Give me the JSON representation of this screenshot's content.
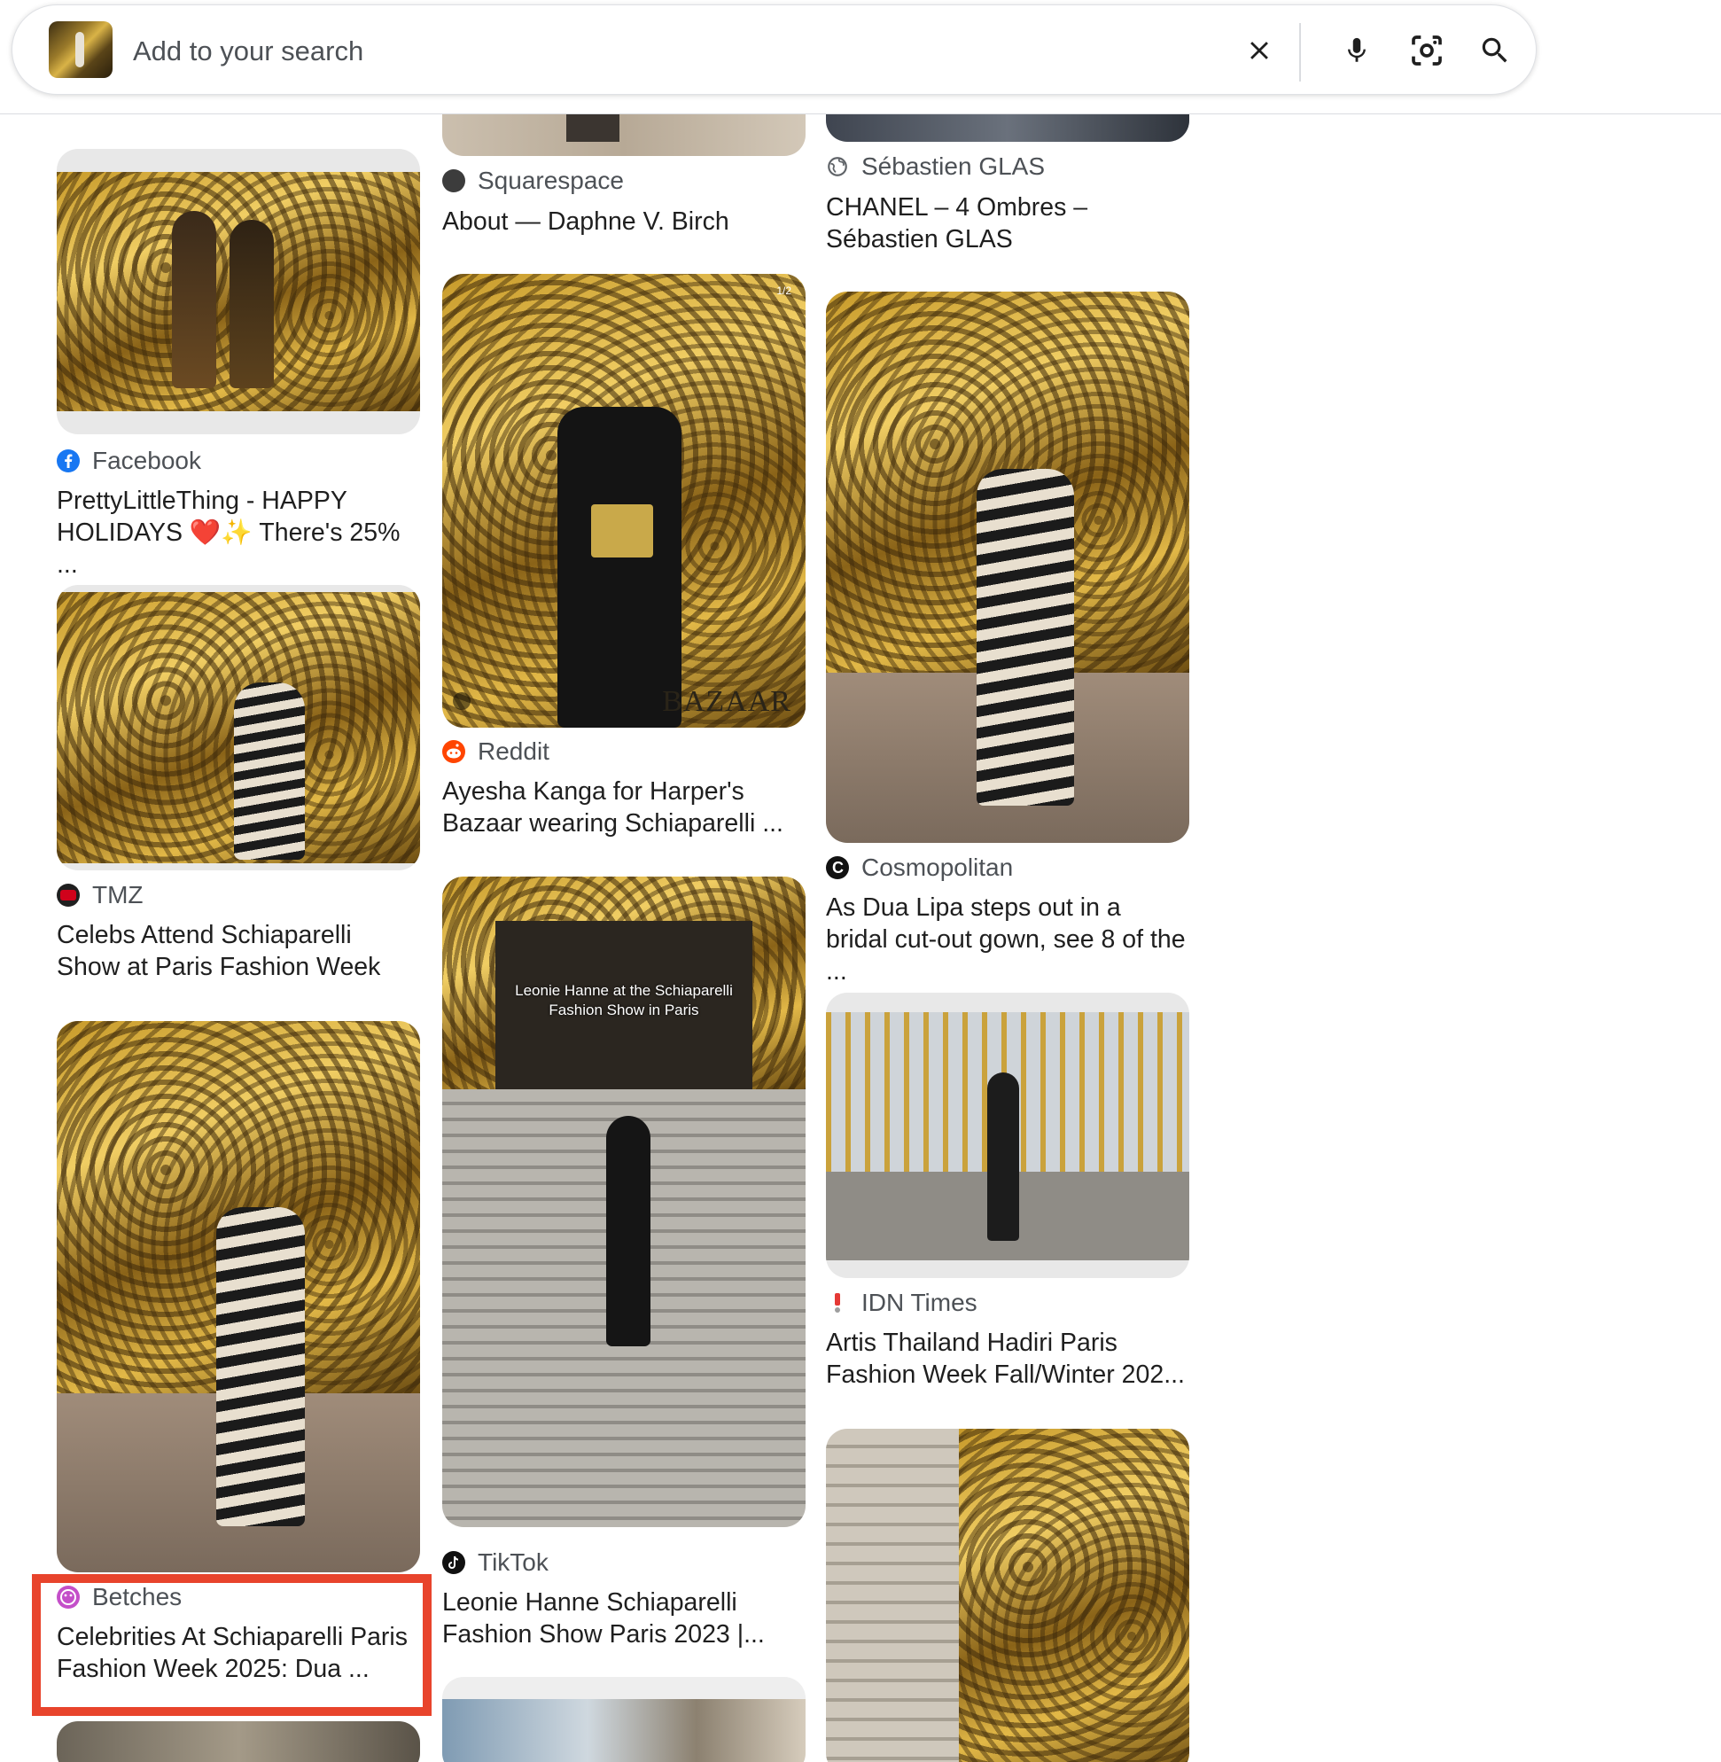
{
  "search": {
    "placeholder": "Add to your search"
  },
  "icons": {
    "clear": "close-icon",
    "voice": "mic-icon",
    "lens": "camera-lens-icon",
    "search": "search-icon"
  },
  "colors": {
    "highlight": "#e8442c",
    "facebook": "#1877f2",
    "reddit": "#ff4500",
    "tmz": "#d0021b",
    "betches": "#c44fc9"
  },
  "results": [
    {
      "source": "Squarespace",
      "title": "About — Daphne V. Birch"
    },
    {
      "source": "Sébastien GLAS",
      "title": "CHANEL – 4 Ombres – Sébastien GLAS"
    },
    {
      "source": "Facebook",
      "title": "PrettyLittleThing - HAPPY HOLIDAYS ❤️✨ There's 25% ..."
    },
    {
      "source": "Reddit",
      "title": "Ayesha Kanga for Harper's Bazaar wearing Schiaparelli ...",
      "overlay": "BAZAAR",
      "counter": "1/2"
    },
    {
      "source": "Cosmopolitan",
      "title": "As Dua Lipa steps out in a bridal cut-out gown, see 8 of the ..."
    },
    {
      "source": "TMZ",
      "title": "Celebs Attend Schiaparelli Show at Paris Fashion Week"
    },
    {
      "source": "TikTok",
      "title": "Leonie Hanne Schiaparelli Fashion Show Paris 2023 |...",
      "overlay": "Leonie Hanne at the Schiaparelli Fashion Show in Paris"
    },
    {
      "source": "IDN Times",
      "title": "Artis Thailand Hadiri Paris Fashion Week Fall/Winter 202..."
    },
    {
      "source": "Betches",
      "title": "Celebrities At Schiaparelli Paris Fashion Week 2025: Dua ..."
    }
  ]
}
